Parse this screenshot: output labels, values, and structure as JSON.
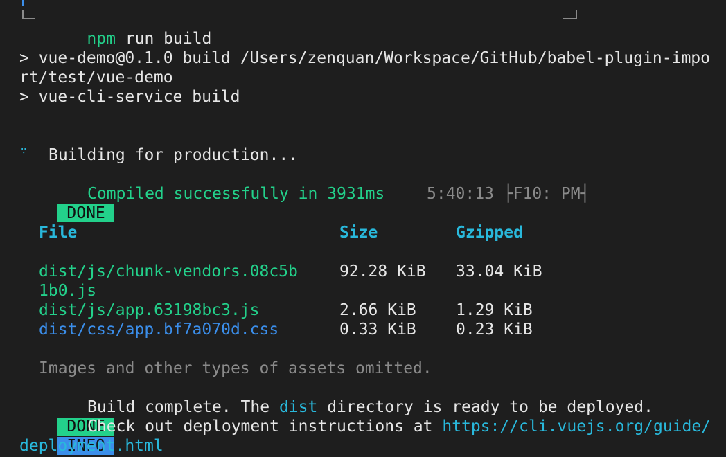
{
  "npm_box": {
    "command_prefix": "npm",
    "command_rest": " run build"
  },
  "npm_output": {
    "line1": "> vue-demo@0.1.0 build /Users/zenquan/Workspace/GitHub/babel-plugin-impo",
    "line2": "rt/test/vue-demo",
    "line3": "> vue-cli-service build"
  },
  "building": {
    "text": "Building for production..."
  },
  "compile": {
    "tag": "DONE",
    "message": "Compiled successfully in 3931ms",
    "time": "5:40:13 ├F10: PM┤"
  },
  "table": {
    "headers": [
      "File",
      "Size",
      "Gzipped"
    ],
    "rows": [
      {
        "file_line1": "dist/js/chunk-vendors.08c5b",
        "file_line2": "1b0.js",
        "size": "92.28 KiB",
        "gzipped": "33.04 KiB"
      },
      {
        "file_line1": "dist/js/app.63198bc3.js",
        "size": "2.66 KiB",
        "gzipped": "1.29 KiB"
      },
      {
        "file_line1": "dist/css/app.bf7a070d.css",
        "size": "0.33 KiB",
        "gzipped": "0.23 KiB"
      }
    ],
    "note": "Images and other types of assets omitted."
  },
  "final": {
    "done_tag": "DONE",
    "done_pre": "Build complete. The ",
    "done_dir": "dist",
    "done_post": " directory is ready to be deployed.",
    "info_tag": "INFO",
    "info_pre": "Check out deployment instructions at ",
    "info_url_line1": "https://cli.vuejs.org/guide/",
    "info_url_line2": "deployment.html"
  },
  "colors": {
    "background": "#1e1e1e",
    "text": "#e6e6e6",
    "green": "#23d18b",
    "cyan": "#29b8db",
    "blue": "#3b8eea",
    "gray": "#8a8a8a"
  },
  "icons": {
    "spinner": "spinner-icon"
  }
}
